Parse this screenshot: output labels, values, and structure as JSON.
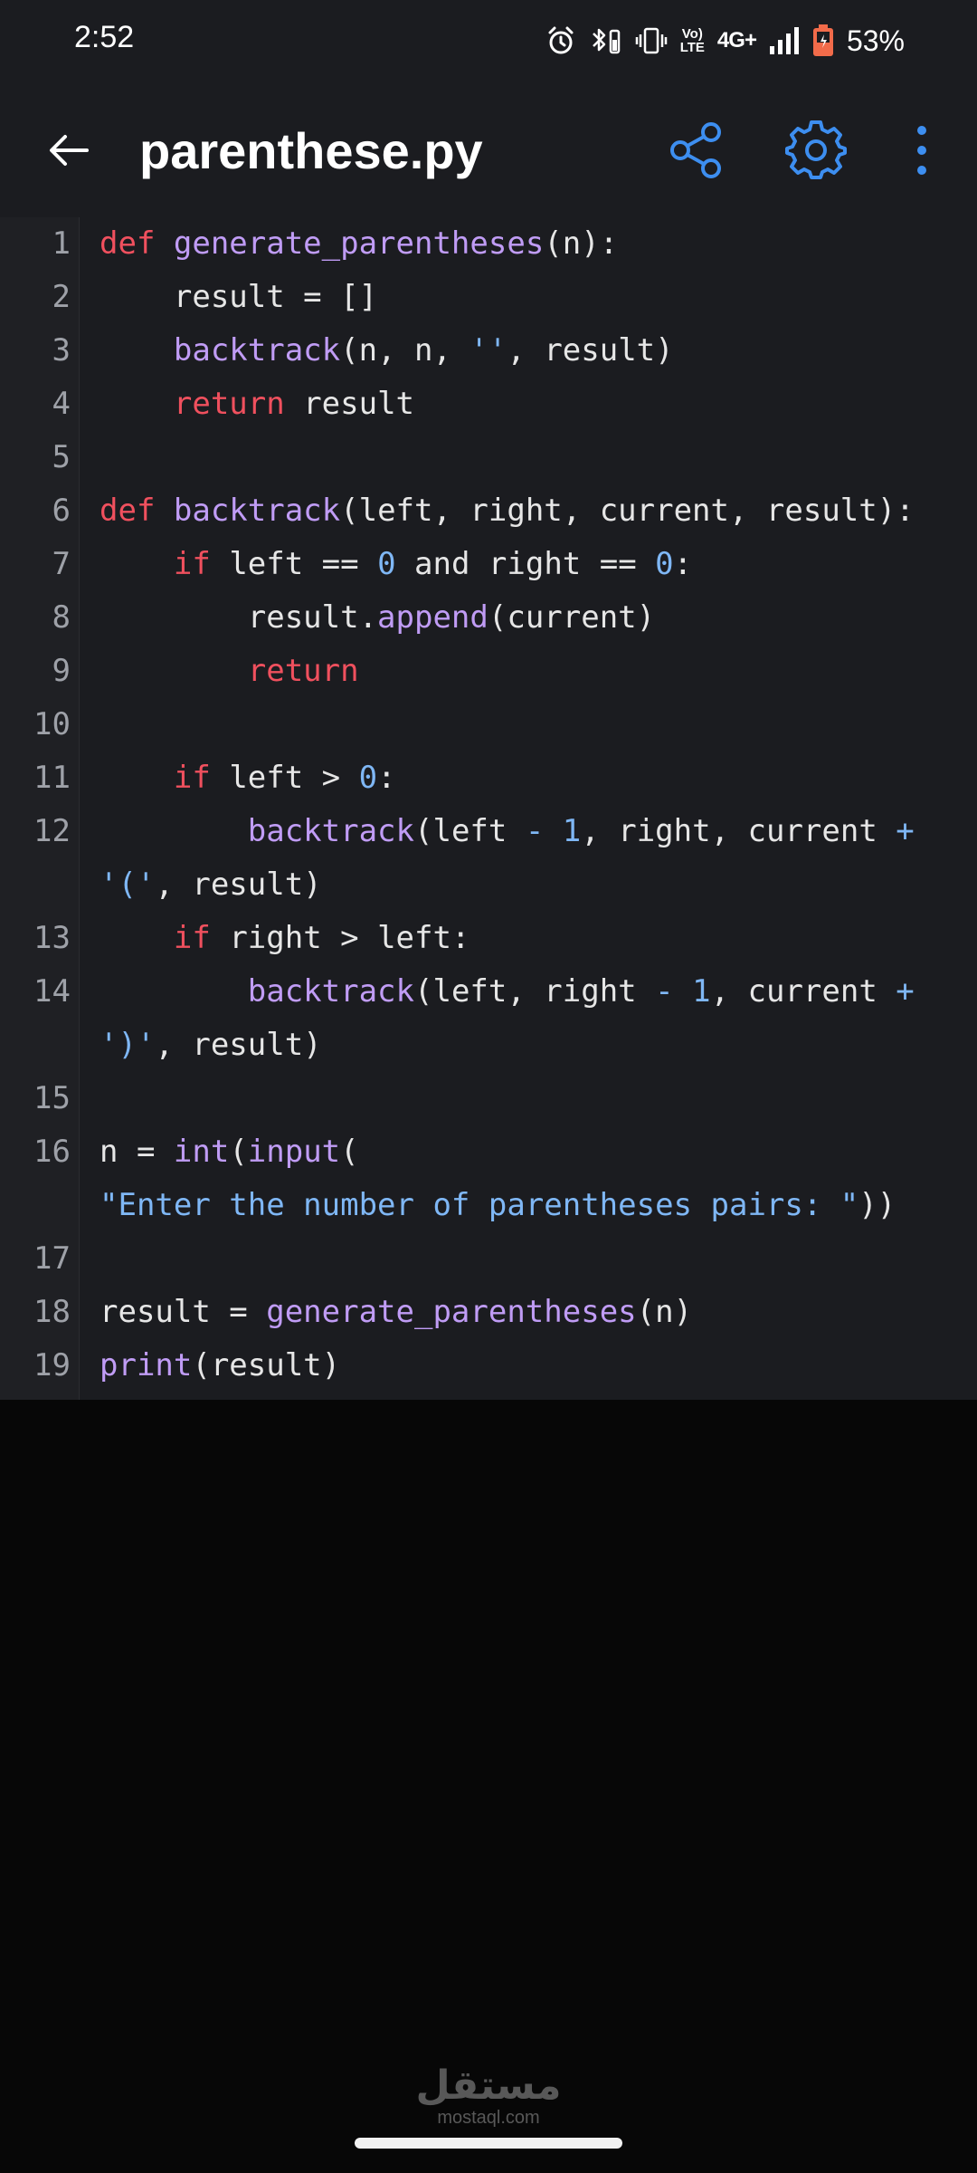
{
  "status_bar": {
    "time": "2:52",
    "network": "4G+",
    "volte_top": "Vo)",
    "volte_bottom": "LTE",
    "battery": "53%",
    "icons": [
      "alarm-icon",
      "bluetooth-battery-icon",
      "vibrate-icon",
      "volte-icon",
      "signal-icon",
      "battery-icon"
    ]
  },
  "app_bar": {
    "title": "parenthese.py",
    "icons": [
      "back-arrow-icon",
      "share-icon",
      "settings-gear-icon",
      "more-vert-icon"
    ],
    "accent_color": "#3d8ef0"
  },
  "editor": {
    "lines": [
      {
        "n": "1",
        "tokens": [
          [
            "kw",
            "def "
          ],
          [
            "fn",
            "generate_parentheses"
          ],
          [
            "plain",
            "(n):"
          ]
        ]
      },
      {
        "n": "2",
        "tokens": [
          [
            "plain",
            "    result = []"
          ]
        ]
      },
      {
        "n": "3",
        "tokens": [
          [
            "plain",
            "    "
          ],
          [
            "fn",
            "backtrack"
          ],
          [
            "plain",
            "(n, n, "
          ],
          [
            "str",
            "''"
          ],
          [
            "plain",
            ", result)"
          ]
        ]
      },
      {
        "n": "4",
        "tokens": [
          [
            "plain",
            "    "
          ],
          [
            "kw",
            "return"
          ],
          [
            "plain",
            " result"
          ]
        ]
      },
      {
        "n": "5",
        "tokens": []
      },
      {
        "n": "6",
        "tokens": [
          [
            "kw",
            "def "
          ],
          [
            "fn",
            "backtrack"
          ],
          [
            "plain",
            "(left, right, current, result):"
          ]
        ]
      },
      {
        "n": "7",
        "tokens": [
          [
            "plain",
            "    "
          ],
          [
            "kw",
            "if"
          ],
          [
            "plain",
            " left == "
          ],
          [
            "num",
            "0"
          ],
          [
            "plain",
            " and right == "
          ],
          [
            "num",
            "0"
          ],
          [
            "plain",
            ":"
          ]
        ]
      },
      {
        "n": "8",
        "tokens": [
          [
            "plain",
            "        result."
          ],
          [
            "fn",
            "append"
          ],
          [
            "plain",
            "(current)"
          ]
        ]
      },
      {
        "n": "9",
        "tokens": [
          [
            "plain",
            "        "
          ],
          [
            "kw",
            "return"
          ]
        ]
      },
      {
        "n": "10",
        "tokens": []
      },
      {
        "n": "11",
        "tokens": [
          [
            "plain",
            "    "
          ],
          [
            "kw",
            "if"
          ],
          [
            "plain",
            " left > "
          ],
          [
            "num",
            "0"
          ],
          [
            "plain",
            ":"
          ]
        ]
      },
      {
        "n": "12",
        "tokens": [
          [
            "plain",
            "        "
          ],
          [
            "fn",
            "backtrack"
          ],
          [
            "plain",
            "(left "
          ],
          [
            "op",
            "-"
          ],
          [
            "plain",
            " "
          ],
          [
            "num",
            "1"
          ],
          [
            "plain",
            ", right, current "
          ],
          [
            "op",
            "+"
          ]
        ]
      },
      {
        "n": "",
        "tokens": [
          [
            "str",
            "'('"
          ],
          [
            "plain",
            ", result)"
          ]
        ]
      },
      {
        "n": "13",
        "tokens": [
          [
            "plain",
            "    "
          ],
          [
            "kw",
            "if"
          ],
          [
            "plain",
            " right > left:"
          ]
        ]
      },
      {
        "n": "14",
        "tokens": [
          [
            "plain",
            "        "
          ],
          [
            "fn",
            "backtrack"
          ],
          [
            "plain",
            "(left, right "
          ],
          [
            "op",
            "-"
          ],
          [
            "plain",
            " "
          ],
          [
            "num",
            "1"
          ],
          [
            "plain",
            ", current "
          ],
          [
            "op",
            "+"
          ]
        ]
      },
      {
        "n": "",
        "tokens": [
          [
            "str",
            "')'"
          ],
          [
            "plain",
            ", result)"
          ]
        ]
      },
      {
        "n": "15",
        "tokens": []
      },
      {
        "n": "16",
        "tokens": [
          [
            "plain",
            "n = "
          ],
          [
            "fn",
            "int"
          ],
          [
            "plain",
            "("
          ],
          [
            "fn",
            "input"
          ],
          [
            "plain",
            "("
          ]
        ]
      },
      {
        "n": "",
        "tokens": [
          [
            "str",
            "\"Enter the number of parentheses pairs: \""
          ],
          [
            "plain",
            "))"
          ]
        ]
      },
      {
        "n": "17",
        "tokens": []
      },
      {
        "n": "18",
        "tokens": [
          [
            "plain",
            "result = "
          ],
          [
            "fn",
            "generate_parentheses"
          ],
          [
            "plain",
            "(n)"
          ]
        ]
      },
      {
        "n": "19",
        "tokens": [
          [
            "fn",
            "print"
          ],
          [
            "plain",
            "(result)"
          ]
        ]
      }
    ]
  },
  "watermark": {
    "arabic": "مستقل",
    "latin": "mostaql.com"
  }
}
